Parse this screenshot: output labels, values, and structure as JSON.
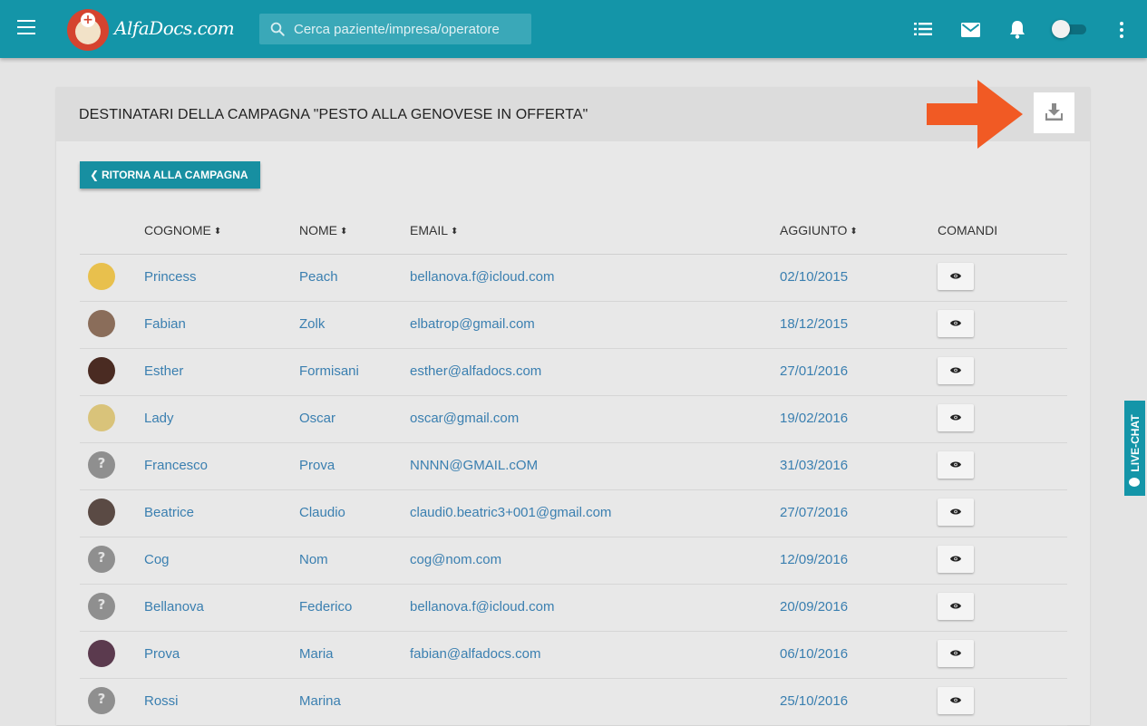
{
  "app": {
    "logo_text": "AlfaDocs.com"
  },
  "search": {
    "placeholder": "Cerca paziente/impresa/operatore"
  },
  "card": {
    "title": "DESTINATARI DELLA CAMPAGNA \"PESTO ALLA GENOVESE IN OFFERTA\"",
    "back_label": "RITORNA ALLA CAMPAGNA"
  },
  "table": {
    "headers": {
      "cognome": "COGNOME",
      "nome": "NOME",
      "email": "EMAIL",
      "aggiunto": "AGGIUNTO",
      "comandi": "COMANDI"
    },
    "rows": [
      {
        "cognome": "Princess",
        "nome": "Peach",
        "email": "bellanova.f@icloud.com",
        "aggiunto": "02/10/2015",
        "avatar": "c1"
      },
      {
        "cognome": "Fabian",
        "nome": "Zolk",
        "email": "elbatrop@gmail.com",
        "aggiunto": "18/12/2015",
        "avatar": "c2"
      },
      {
        "cognome": "Esther",
        "nome": "Formisani",
        "email": "esther@alfadocs.com",
        "aggiunto": "27/01/2016",
        "avatar": "c3"
      },
      {
        "cognome": "Lady",
        "nome": "Oscar",
        "email": "oscar@gmail.com",
        "aggiunto": "19/02/2016",
        "avatar": "c4"
      },
      {
        "cognome": "Francesco",
        "nome": "Prova",
        "email": "NNNN@GMAIL.cOM",
        "aggiunto": "31/03/2016",
        "avatar": "unknown"
      },
      {
        "cognome": "Beatrice",
        "nome": "Claudio",
        "email": "claudi0.beatric3+001@gmail.com",
        "aggiunto": "27/07/2016",
        "avatar": "c5"
      },
      {
        "cognome": "Cog",
        "nome": "Nom",
        "email": "cog@nom.com",
        "aggiunto": "12/09/2016",
        "avatar": "unknown"
      },
      {
        "cognome": "Bellanova",
        "nome": "Federico",
        "email": "bellanova.f@icloud.com",
        "aggiunto": "20/09/2016",
        "avatar": "unknown"
      },
      {
        "cognome": "Prova",
        "nome": "Maria",
        "email": "fabian@alfadocs.com",
        "aggiunto": "06/10/2016",
        "avatar": "c6"
      },
      {
        "cognome": "Rossi",
        "nome": "Marina",
        "email": "",
        "aggiunto": "25/10/2016",
        "avatar": "unknown"
      }
    ]
  },
  "livechat": {
    "label": "LIVE-CHAT"
  },
  "icons": {
    "menu": "hamburger-icon",
    "search": "search-icon",
    "list": "list-icon",
    "mail": "mail-icon",
    "notifications": "bell-icon",
    "toggle": "toggle-switch",
    "more": "kebab-icon",
    "download": "download-icon",
    "view": "eye-icon",
    "back": "chevron-left-icon",
    "sort": "sort-icon"
  },
  "colors": {
    "topbar": "#1495a8",
    "accent": "#178fa1",
    "link": "#3a7fb0",
    "annotation_arrow": "#f15a24"
  }
}
